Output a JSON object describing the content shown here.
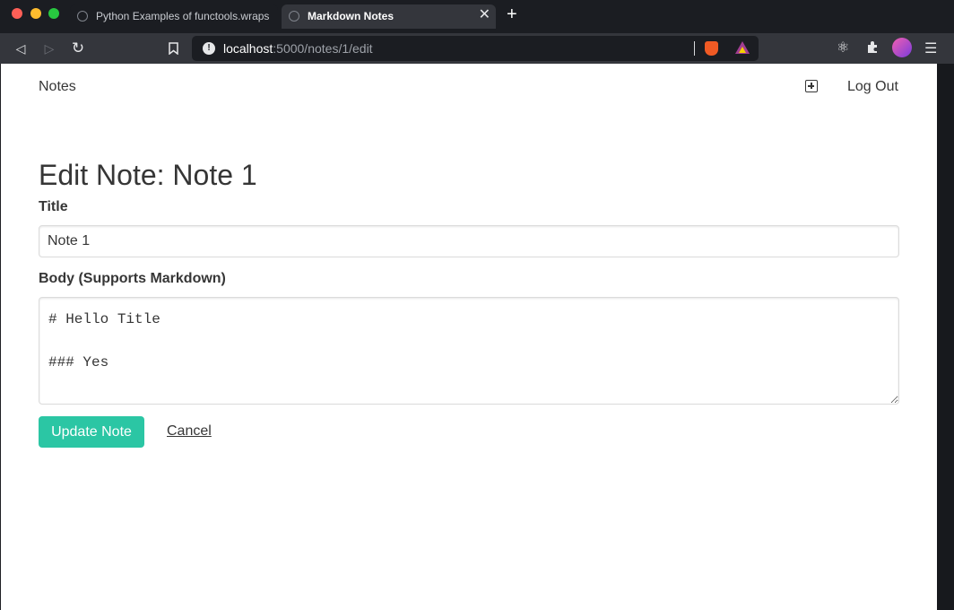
{
  "browser": {
    "tabs": [
      {
        "title": "Python Examples of functools.wraps",
        "active": false
      },
      {
        "title": "Markdown Notes",
        "active": true
      }
    ],
    "url": {
      "host": "localhost",
      "rest": ":5000/notes/1/edit"
    },
    "icons": [
      "back-icon",
      "forward-icon",
      "reload-icon",
      "bookmark-icon",
      "info-icon",
      "brave-shield-icon",
      "brave-rewards-icon",
      "react-devtools-icon",
      "extensions-icon",
      "profile-avatar",
      "menu-icon"
    ]
  },
  "nav": {
    "brand": "Notes",
    "new_note_icon": "plus-square-icon",
    "logout": "Log Out"
  },
  "form": {
    "heading": "Edit Note: Note 1",
    "title_label": "Title",
    "title_value": "Note 1",
    "body_label": "Body (Supports Markdown)",
    "body_value": "# Hello Title\n\n### Yes",
    "submit_label": "Update Note",
    "cancel_label": "Cancel"
  },
  "colors": {
    "accent": "#2bc6a4",
    "text": "#363636",
    "browser_bg": "#1b1d22"
  }
}
